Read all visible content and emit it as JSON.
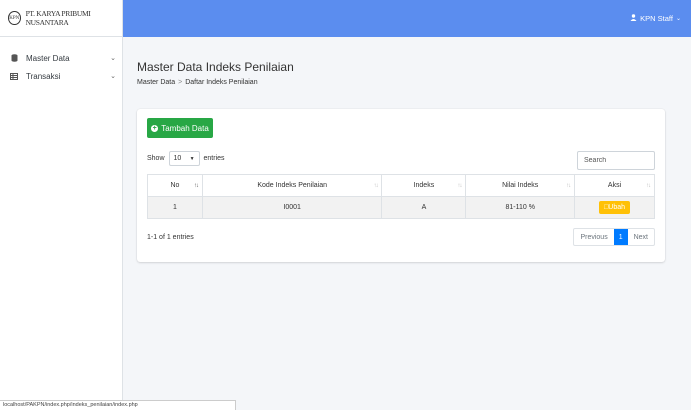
{
  "brand": {
    "name": "PT. KARYA PRIBUMI NUSANTARA",
    "logo_text": "KPN"
  },
  "sidebar": {
    "items": [
      {
        "label": "Master Data",
        "icon": "database-icon"
      },
      {
        "label": "Transaksi",
        "icon": "table-icon"
      }
    ]
  },
  "topbar": {
    "user": "KPN Staff"
  },
  "page": {
    "title": "Master Data Indeks Penilaian",
    "breadcrumb": [
      "Master Data",
      "Daftar Indeks Penilaian"
    ],
    "breadcrumb_sep": ">"
  },
  "card": {
    "add_button": "Tambah Data",
    "show_label": "Show",
    "entries_value": "10",
    "entries_label": "entries",
    "search_placeholder": "Search",
    "columns": [
      "No",
      "Kode Indeks Penilaian",
      "Indeks",
      "Nilai Indeks",
      "Aksi"
    ],
    "rows": [
      {
        "no": "1",
        "kode": "I0001",
        "indeks": "A",
        "nilai": "81-110 %",
        "aksi": "Ubah"
      }
    ],
    "info": "1-1 of 1 entries",
    "pagination": {
      "previous": "Previous",
      "current": "1",
      "next": "Next"
    }
  },
  "status_url": "localhost/PAKPN/index.php/indeks_penilaian/index.php",
  "colors": {
    "topbar": "#5b8def",
    "add": "#28a745",
    "edit": "#ffc107",
    "page_active": "#007bff"
  }
}
